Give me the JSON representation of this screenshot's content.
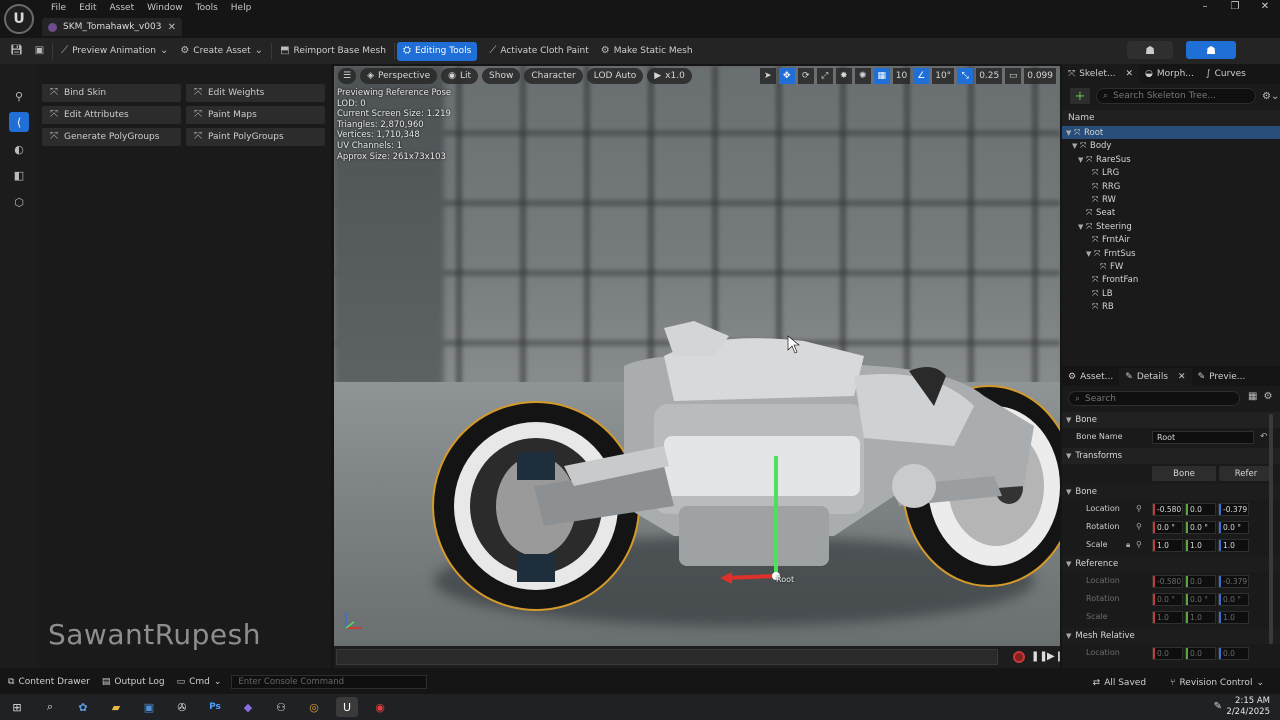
{
  "window": {
    "menu": [
      "File",
      "Edit",
      "Asset",
      "Window",
      "Tools",
      "Help"
    ],
    "document_tab": "SKM_Tomahawk_v003",
    "logo": "unreal-logo"
  },
  "toolbar": {
    "preview_animation": "Preview Animation",
    "create_asset": "Create Asset",
    "reimport_base_mesh": "Reimport Base Mesh",
    "editing_tools": "Editing Tools",
    "activate_cloth_paint": "Activate Cloth Paint",
    "make_static_mesh": "Make Static Mesh"
  },
  "tool_panel": {
    "buttons": [
      "Bind Skin",
      "Edit Weights",
      "Edit Attributes",
      "Paint Maps",
      "Generate PolyGroups",
      "Paint PolyGroups"
    ]
  },
  "watermark": "SawantRupesh",
  "viewport": {
    "perspective": "Perspective",
    "lit": "Lit",
    "show": "Show",
    "character": "Character",
    "lod": "LOD Auto",
    "speed": "x1.0",
    "grid_snap": "10",
    "rot_snap": "10°",
    "scale_snap": "0.25",
    "camera_speed": "0.099",
    "info": [
      "Previewing Reference Pose",
      "LOD: 0",
      "Current Screen Size: 1.219",
      "Triangles: 2,870,960",
      "Vertices: 1,710,348",
      "UV Channels: 1",
      "Approx Size: 261x73x103"
    ],
    "root_label": "Root"
  },
  "skeleton_panel": {
    "tabs": [
      "Skelet...",
      "Morph...",
      "Curves"
    ],
    "search_placeholder": "Search Skeleton Tree...",
    "column_name": "Name",
    "tree": [
      {
        "name": "Root",
        "depth": 0,
        "expanded": true,
        "selected": true
      },
      {
        "name": "Body",
        "depth": 1,
        "expanded": true
      },
      {
        "name": "RareSus",
        "depth": 2,
        "expanded": true
      },
      {
        "name": "LRG",
        "depth": 3
      },
      {
        "name": "RRG",
        "depth": 3
      },
      {
        "name": "RW",
        "depth": 3
      },
      {
        "name": "Seat",
        "depth": 2
      },
      {
        "name": "Steering",
        "depth": 2,
        "expanded": true
      },
      {
        "name": "FrntAir",
        "depth": 3
      },
      {
        "name": "FrntSus",
        "depth": 3,
        "expanded": true
      },
      {
        "name": "FW",
        "depth": 4
      },
      {
        "name": "FrontFan",
        "depth": 3
      },
      {
        "name": "LB",
        "depth": 3
      },
      {
        "name": "RB",
        "depth": 3
      }
    ]
  },
  "details_panel": {
    "tabs": [
      "Asset...",
      "Details",
      "Previe..."
    ],
    "search_placeholder": "Search",
    "section_bone": "Bone",
    "bone_name_label": "Bone Name",
    "bone_name_value": "Root",
    "section_transforms": "Transforms",
    "btn_bone": "Bone",
    "btn_refer": "Refer",
    "subsection_bone": "Bone",
    "location_label": "Location",
    "rotation_label": "Rotation",
    "scale_label": "Scale",
    "bone_location": [
      "-0.580",
      "0.0",
      "-0.379"
    ],
    "bone_rotation": [
      "0.0 °",
      "0.0 °",
      "0.0 °"
    ],
    "bone_scale": [
      "1.0",
      "1.0",
      "1.0"
    ],
    "subsection_reference": "Reference",
    "ref_location": [
      "-0.580",
      "0.0",
      "-0.379"
    ],
    "ref_rotation": [
      "0.0 °",
      "0.0 °",
      "0.0 °"
    ],
    "ref_scale": [
      "1.0",
      "1.0",
      "1.0"
    ],
    "subsection_mesh_relative": "Mesh Relative",
    "mesh_location": [
      "0.0",
      "0.0",
      "0.0"
    ]
  },
  "statusbar": {
    "content_drawer": "Content Drawer",
    "output_log": "Output Log",
    "cmd": "Cmd",
    "console_placeholder": "Enter Console Command",
    "all_saved": "All Saved",
    "revision_control": "Revision Control"
  },
  "taskbar": {
    "time": "2:15 AM",
    "date": "2/24/2025"
  },
  "colors": {
    "accent_blue": "#1f6fd6",
    "selected_row": "#284d78",
    "add_green": "#5dc04a"
  }
}
